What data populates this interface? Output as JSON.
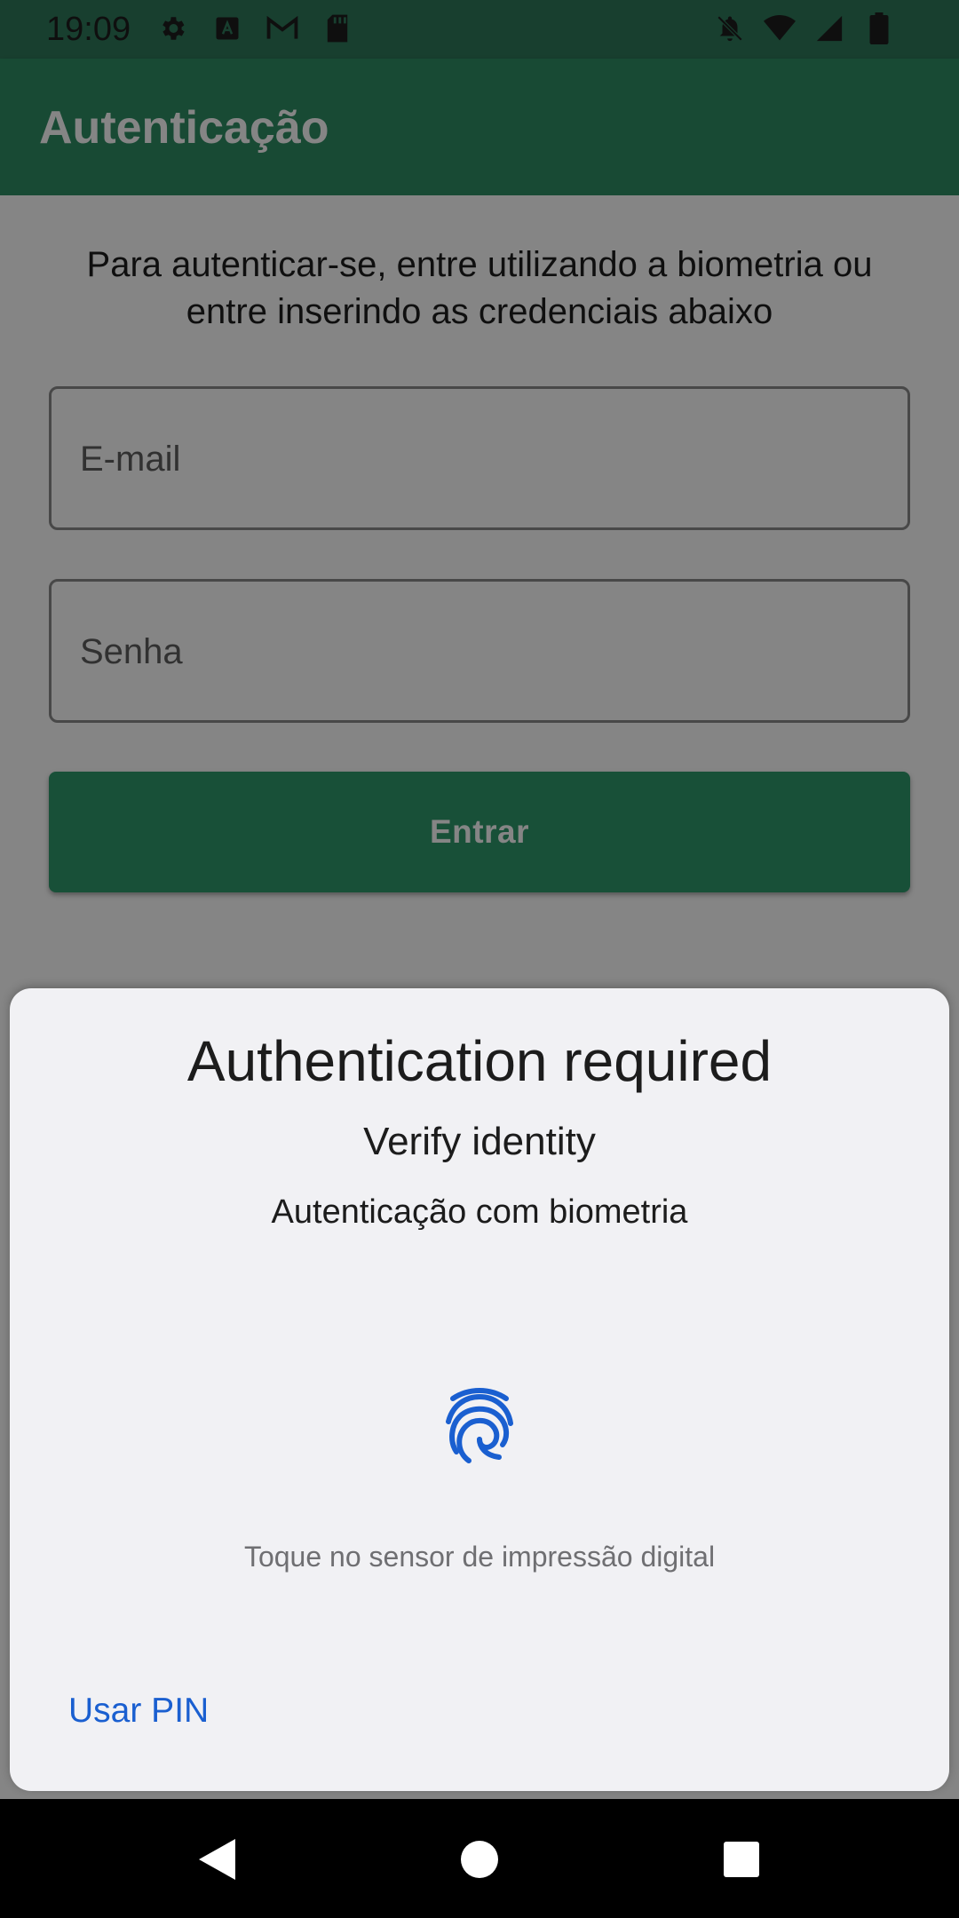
{
  "status_bar": {
    "time": "19:09",
    "left_icons": [
      "gear-icon",
      "font-app-icon",
      "gmail-icon",
      "sd-card-icon"
    ],
    "right_icons": [
      "notifications-off-icon",
      "wifi-icon",
      "signal-icon",
      "battery-icon"
    ]
  },
  "app_bar": {
    "title": "Autenticação"
  },
  "form": {
    "intro": "Para autenticar-se, entre utilizando a biometria ou entre inserindo as credenciais abaixo",
    "email_placeholder": "E-mail",
    "email_value": "",
    "password_placeholder": "Senha",
    "password_value": "",
    "login_label": "Entrar"
  },
  "biometric_prompt": {
    "title": "Authentication required",
    "subtitle": "Verify identity",
    "description": "Autenticação com biometria",
    "icon": "fingerprint-icon",
    "hint": "Toque no sensor de impressão digital",
    "negative_button": "Usar PIN"
  },
  "nav_bar": {
    "buttons": [
      "back-icon",
      "home-icon",
      "recents-icon"
    ]
  },
  "colors": {
    "primary": "#2f8f65",
    "primary_dark": "#2f7a5b",
    "accent_blue": "#1a5fd0",
    "sheet_background": "#f1f1f4"
  }
}
